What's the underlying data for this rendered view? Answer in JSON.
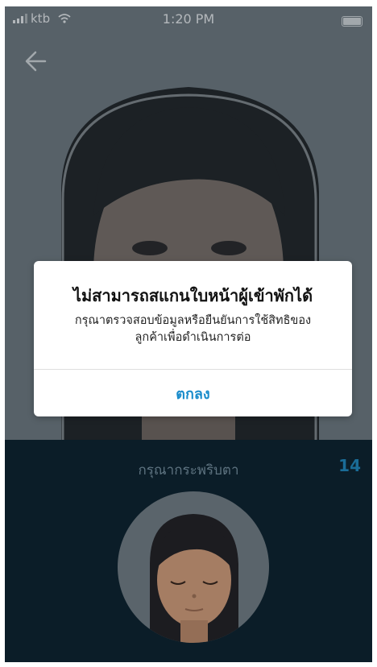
{
  "status_bar": {
    "carrier": "ktb",
    "time": "1:20 PM",
    "icons": [
      "signal-icon",
      "wifi-icon",
      "battery-icon"
    ]
  },
  "nav": {
    "back_icon": "arrow-left-icon"
  },
  "scan": {
    "instruction": "กรุณากระพริบตา",
    "countdown": "14"
  },
  "dialog": {
    "title": "ไม่สามารถสแกนใบหน้าผู้เข้าพักได้",
    "message_line1": "กรุณาตรวจสอบข้อมูลหรือยืนยันการใช้สิทธิของ",
    "message_line2": "ลูกค้าเพื่อดำเนินการต่อ",
    "ok_label": "ตกลง"
  },
  "colors": {
    "accent": "#1a8ccb",
    "panel": "#0b1d28",
    "countdown": "#1a6c97"
  }
}
